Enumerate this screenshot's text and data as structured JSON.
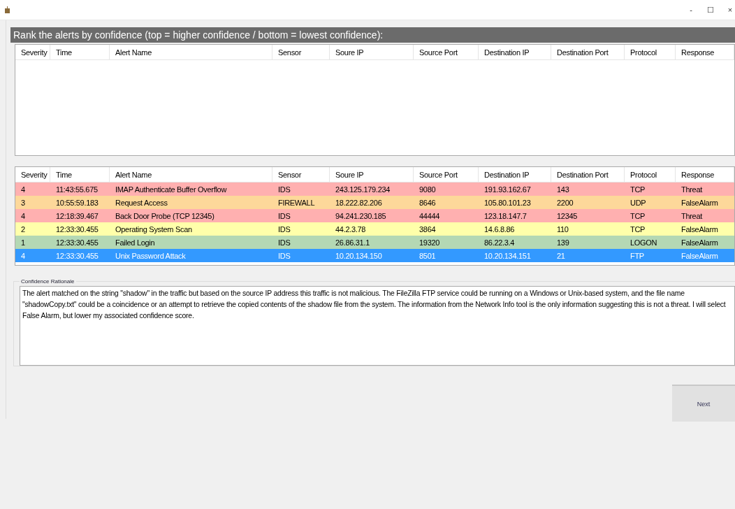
{
  "window": {
    "controls": [
      "-",
      "☐",
      "×"
    ]
  },
  "instruction": "Rank the alerts by confidence (top = higher confidence / bottom = lowest confidence):",
  "ranked_table": {
    "columns": [
      "Severity",
      "Time",
      "Alert Name",
      "Sensor",
      "Soure IP",
      "Source Port",
      "Destination IP",
      "Destination Port",
      "Protocol",
      "Response"
    ]
  },
  "alerts_table": {
    "columns": [
      "Severity",
      "Time",
      "Alert Name",
      "Sensor",
      "Soure IP",
      "Source Port",
      "Destination IP",
      "Destination Port",
      "Protocol",
      "Response"
    ],
    "rows": [
      {
        "cells": [
          "4",
          "11:43:55.675",
          "IMAP Authenticate Buffer Overflow",
          "IDS",
          "243.125.179.234",
          "9080",
          "191.93.162.67",
          "143",
          "TCP",
          "Threat"
        ],
        "color": "#ffb0b0",
        "selected": false
      },
      {
        "cells": [
          "3",
          "10:55:59.183",
          "Request Access",
          "FIREWALL",
          "18.222.82.206",
          "8646",
          "105.80.101.23",
          "2200",
          "UDP",
          "FalseAlarm"
        ],
        "color": "#fdd89a",
        "selected": false
      },
      {
        "cells": [
          "4",
          "12:18:39.467",
          "Back Door Probe (TCP 12345)",
          "IDS",
          "94.241.230.185",
          "44444",
          "123.18.147.7",
          "12345",
          "TCP",
          "Threat"
        ],
        "color": "#ffb0b0",
        "selected": false
      },
      {
        "cells": [
          "2",
          "12:33:30.455",
          "Operating System Scan",
          "IDS",
          "44.2.3.78",
          "3864",
          "14.6.8.86",
          "110",
          "TCP",
          "FalseAlarm"
        ],
        "color": "#ffffaa",
        "selected": false
      },
      {
        "cells": [
          "1",
          "12:33:30.455",
          "Failed Login",
          "IDS",
          "26.86.31.1",
          "19320",
          "86.22.3.4",
          "139",
          "LOGON",
          "FalseAlarm"
        ],
        "color": "#b4d8b4",
        "selected": false
      },
      {
        "cells": [
          "4",
          "12:33:30.455",
          "Unix Password Attack",
          "IDS",
          "10.20.134.150",
          "8501",
          "10.20.134.151",
          "21",
          "FTP",
          "FalseAlarm"
        ],
        "selected": true
      }
    ]
  },
  "rationale": {
    "label": "Confidence Rationale",
    "value": "The alert matched on the string \"shadow\" in the traffic but based on the source IP address this traffic is not malicious. The FileZilla FTP service could be running on a Windows or Unix-based system, and the file name \"shadowCopy.txt\" could be a coincidence or an attempt to retrieve the copied contents of the shadow file from the system. The information from the Network Info tool is the only information suggesting this is not a threat. I will select False Alarm, but lower my associated confidence score."
  },
  "next_button": "Next"
}
